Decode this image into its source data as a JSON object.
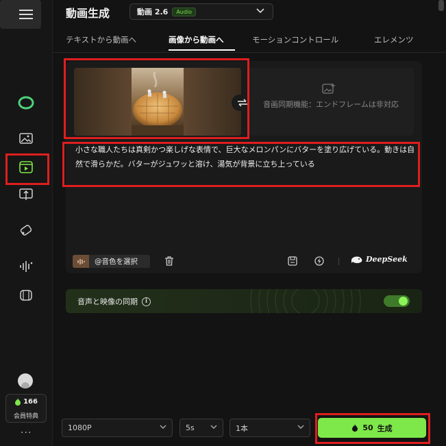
{
  "header": {
    "title": "動画生成",
    "model_name": "動画 2.6",
    "model_badge": "Audio"
  },
  "tabs": [
    {
      "label": "テキストから動画へ",
      "active": false
    },
    {
      "label": "画像から動画へ",
      "active": true
    },
    {
      "label": "モーションコントロール",
      "active": false
    },
    {
      "label": "エレメンツ",
      "active": false
    }
  ],
  "frames": {
    "end_frame_text": "音画同期機能：エンドフレームは非対応"
  },
  "prompt": {
    "text": "小さな職人たちは真剣かつ楽しげな表情で、巨大なメロンパンにバターを塗り広げている。動きは自然で滑らかだ。バターがジュワッと溶け、湯気が背景に立ち上っている"
  },
  "toolbar": {
    "voice_label": "@音色を選択",
    "deepseek_label": "DeepSeek"
  },
  "audio_sync": {
    "label": "音声と映像の同期",
    "info": "i",
    "enabled": true
  },
  "sidebar": {
    "credits": "166",
    "member_label": "会員特典",
    "more": "···"
  },
  "bottom": {
    "resolution": "1080P",
    "duration": "5s",
    "count": "1本",
    "generate_cost": "50",
    "generate_label": "生成"
  },
  "colors": {
    "accent_green": "#7ee84a",
    "highlight_red": "#e01e1e",
    "background": "#131313"
  }
}
